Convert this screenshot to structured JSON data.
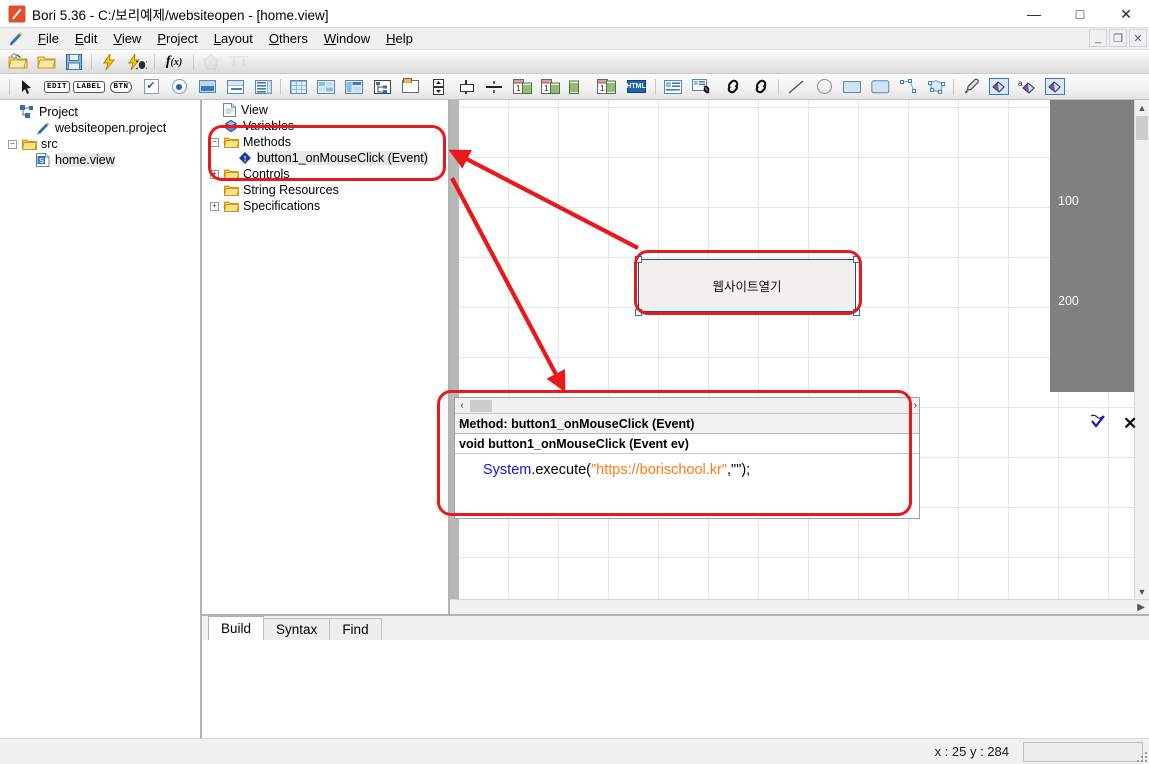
{
  "window": {
    "app_name": "Bori 5.36",
    "title": "Bori 5.36 - C:/보리예제/websiteopen - [home.view]",
    "minimize": "—",
    "maximize": "□",
    "close": "✕"
  },
  "mdi": {
    "minimize": "_",
    "restore": "❐",
    "close": "✕"
  },
  "menu": {
    "items": [
      {
        "label": "File",
        "accel": "F"
      },
      {
        "label": "Edit",
        "accel": "E"
      },
      {
        "label": "View",
        "accel": "V"
      },
      {
        "label": "Project",
        "accel": "P"
      },
      {
        "label": "Layout",
        "accel": "L"
      },
      {
        "label": "Others",
        "accel": "O"
      },
      {
        "label": "Window",
        "accel": "W"
      },
      {
        "label": "Help",
        "accel": "H"
      }
    ]
  },
  "toolbar_main": {
    "items": [
      {
        "name": "open-project-icon",
        "label": ""
      },
      {
        "name": "open-folder-icon",
        "label": ""
      },
      {
        "name": "save-icon",
        "label": ""
      },
      {
        "name": "run-icon",
        "label": ""
      },
      {
        "name": "debug-icon",
        "label": ""
      },
      {
        "name": "function-icon",
        "label": "f(x)"
      },
      {
        "name": "shape-icon",
        "label": ""
      },
      {
        "name": "text-format-icon",
        "label": "TT"
      }
    ]
  },
  "toolbar_widgets": {
    "items": [
      {
        "name": "pointer-icon",
        "label": ""
      },
      {
        "name": "edit-widget-icon",
        "label": "EDIT"
      },
      {
        "name": "label-widget-icon",
        "label": "LABEL"
      },
      {
        "name": "button-widget-icon",
        "label": "BTN"
      },
      {
        "name": "checkbox-widget-icon",
        "label": ""
      },
      {
        "name": "radio-widget-icon",
        "label": ""
      },
      {
        "name": "image-widget-icon",
        "label": ""
      },
      {
        "name": "panel-widget-icon",
        "label": ""
      },
      {
        "name": "listbox-widget-icon",
        "label": ""
      },
      {
        "name": "grid-widget-icon",
        "label": ""
      },
      {
        "name": "table-widget-icon",
        "label": ""
      },
      {
        "name": "datagrid-widget-icon",
        "label": ""
      },
      {
        "name": "treeview-widget-icon",
        "label": ""
      },
      {
        "name": "tree-widget-icon",
        "label": ""
      },
      {
        "name": "tab-widget-icon",
        "label": ""
      },
      {
        "name": "spinner-widget-icon",
        "label": ""
      },
      {
        "name": "slider-widget-icon",
        "label": ""
      },
      {
        "name": "separator-widget-icon",
        "label": ""
      },
      {
        "name": "calendar-widget-icon",
        "label": ""
      },
      {
        "name": "date-widget-icon",
        "label": ""
      },
      {
        "name": "time-widget-icon",
        "label": ""
      },
      {
        "name": "calendar2-widget-icon",
        "label": ""
      },
      {
        "name": "html-widget-icon",
        "label": "HTML"
      },
      {
        "name": "form-widget-icon",
        "label": ""
      },
      {
        "name": "link-form-icon",
        "label": ""
      },
      {
        "name": "link-icon",
        "label": ""
      },
      {
        "name": "link2-icon",
        "label": ""
      },
      {
        "name": "line-tool-icon",
        "label": ""
      },
      {
        "name": "ellipse-tool-icon",
        "label": ""
      },
      {
        "name": "rectangle-tool-icon",
        "label": ""
      },
      {
        "name": "rounded-rect-tool-icon",
        "label": ""
      },
      {
        "name": "polyline-tool-icon",
        "label": ""
      },
      {
        "name": "polygon-tool-icon",
        "label": ""
      },
      {
        "name": "eyedropper-icon",
        "label": ""
      },
      {
        "name": "fill-color-icon",
        "label": ""
      },
      {
        "name": "text-color-icon",
        "label": ""
      },
      {
        "name": "background-color-icon",
        "label": ""
      }
    ]
  },
  "project_tree": {
    "root_label": "Project",
    "nodes": [
      {
        "label": "websiteopen.project",
        "icon": "project-file-icon",
        "level": 2,
        "expander": "none",
        "selected": false
      },
      {
        "label": "src",
        "icon": "folder-icon",
        "level": 1,
        "expander": "minus",
        "selected": false
      },
      {
        "label": "home.view",
        "icon": "view-file-icon",
        "level": 2,
        "expander": "none",
        "selected": true
      }
    ]
  },
  "view_tree": {
    "root_label": "View",
    "nodes": [
      {
        "label": "Variables",
        "icon": "variables-icon",
        "level": 1,
        "expander": "none",
        "selected": false
      },
      {
        "label": "Methods",
        "icon": "folder-icon",
        "level": 1,
        "expander": "minus",
        "selected": false
      },
      {
        "label": "button1_onMouseClick (Event)",
        "icon": "event-method-icon",
        "level": 2,
        "expander": "none",
        "selected": true
      },
      {
        "label": "Controls",
        "icon": "folder-icon",
        "level": 1,
        "expander": "plus",
        "selected": false
      },
      {
        "label": "String Resources",
        "icon": "folder-icon",
        "level": 1,
        "expander": "none",
        "selected": false
      },
      {
        "label": "Specifications",
        "icon": "folder-icon",
        "level": 1,
        "expander": "plus",
        "selected": false
      }
    ]
  },
  "canvas": {
    "button_label": "웹사이트열기",
    "ruler_labels": [
      "100",
      "200"
    ],
    "grid_size_px": 50
  },
  "code_panel": {
    "method_header": "Method: button1_onMouseClick (Event)",
    "signature": "void button1_onMouseClick (Event ev)",
    "code_parts": {
      "system": "System",
      "dot_call": ".execute(",
      "url_string": "\"https://borischool.kr\"",
      "tail": ",\"\");"
    },
    "validate_icon": "check-icon",
    "close_icon": "close-icon",
    "scroll_left": "‹",
    "scroll_right": "›"
  },
  "bottom_tabs": {
    "tabs": [
      {
        "label": "Build",
        "active": true
      },
      {
        "label": "Syntax",
        "active": false
      },
      {
        "label": "Find",
        "active": false
      }
    ]
  },
  "statusbar": {
    "coords": "x : 25  y : 284"
  },
  "colors": {
    "annotation_red": "#e8191b",
    "selection_blue": "#2f6fb5",
    "keyword_blue": "#1414e6",
    "string_orange": "#ff7b16",
    "ruler_gray": "#808080"
  }
}
